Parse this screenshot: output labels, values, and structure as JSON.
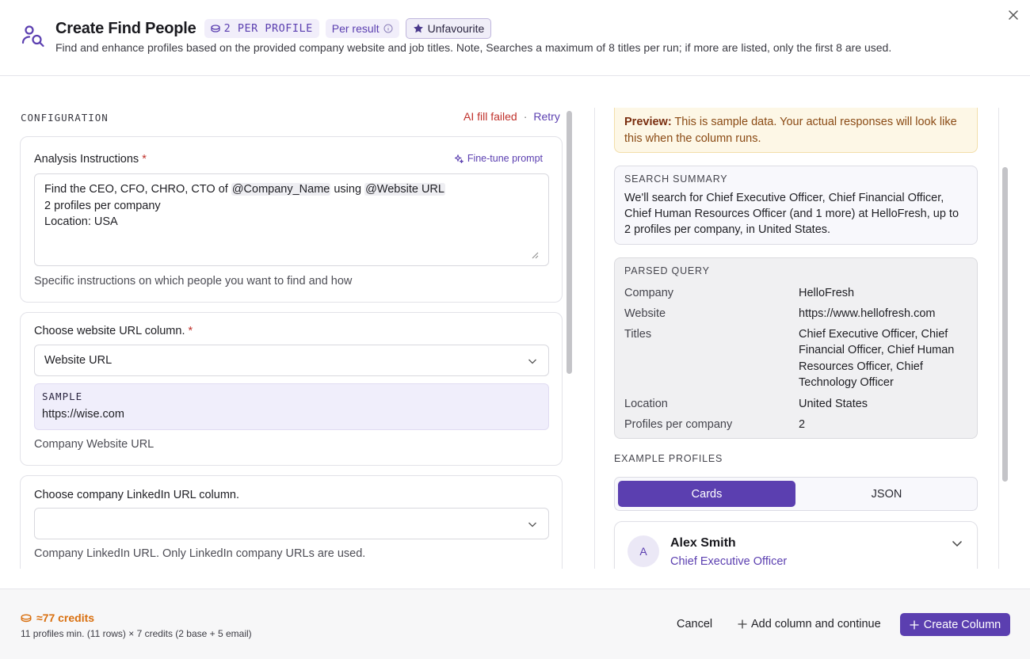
{
  "header": {
    "title": "Create Find People",
    "badge_cost": "2 PER PROFILE",
    "badge_per_result": "Per result",
    "favourite_label": "Unfavourite",
    "subtitle": "Find and enhance profiles based on the provided company website and job titles. Note, Searches a maximum of 8 titles per run; if more are listed, only the first 8 are used."
  },
  "config": {
    "section_label": "CONFIGURATION",
    "ai_status": "AI fill failed",
    "ai_separator": "·",
    "retry_label": "Retry",
    "analysis": {
      "label": "Analysis Instructions",
      "required_mark": "*",
      "finetune_label": "Fine-tune prompt",
      "line1_pre": "Find the CEO, CFO, CHRO, CTO of ",
      "mention_company": "@Company_Name",
      "line1_mid": " using ",
      "mention_website": "@Website URL",
      "line2": "2 profiles per company",
      "line3": "Location: USA",
      "help": "Specific instructions on which people you want to find and how"
    },
    "website": {
      "label": "Choose website URL column.",
      "required_mark": "*",
      "selected": "Website URL",
      "sample_label": "SAMPLE",
      "sample_value": "https://wise.com",
      "help": "Company Website URL"
    },
    "linkedin": {
      "label": "Choose company LinkedIn URL column.",
      "selected": "",
      "help": "Company LinkedIn URL. Only LinkedIn company URLs are used."
    }
  },
  "preview": {
    "notice_bold": "Preview:",
    "notice_text": " This is sample data. Your actual responses will look like this when the column runs.",
    "summary_label": "SEARCH SUMMARY",
    "summary_text": "We'll search for Chief Executive Officer, Chief Financial Officer, Chief Human Resources Officer (and 1 more) at HelloFresh, up to 2 profiles per company, in United States.",
    "parsed_label": "PARSED QUERY",
    "parsed": [
      {
        "key": "Company",
        "value": "HelloFresh"
      },
      {
        "key": "Website",
        "value": "https://www.hellofresh.com"
      },
      {
        "key": "Titles",
        "value": "Chief Executive Officer, Chief Financial Officer, Chief Human Resources Officer, Chief Technology Officer"
      },
      {
        "key": "Location",
        "value": "United States"
      },
      {
        "key": "Profiles per company",
        "value": "2"
      }
    ],
    "examples_label": "EXAMPLE PROFILES",
    "tab_cards": "Cards",
    "tab_json": "JSON",
    "profile": {
      "initial": "A",
      "name": "Alex Smith",
      "role": "Chief Executive Officer"
    }
  },
  "footer": {
    "credits": "≈77 credits",
    "credits_detail": "11 profiles min. (11 rows) × 7 credits (2 base + 5 email)",
    "cancel_label": "Cancel",
    "add_continue_label": "Add column and continue",
    "create_label": "Create Column"
  },
  "colors": {
    "accent": "#5b3fb0",
    "error": "#c0312b",
    "credits": "#d96f0e",
    "preview_bg": "#fdf7e6"
  },
  "icons": [
    "find-people-icon",
    "coin-icon",
    "info-icon",
    "star-icon",
    "close-icon",
    "sparkle-icon",
    "chevron-down-icon",
    "plus-icon"
  ]
}
